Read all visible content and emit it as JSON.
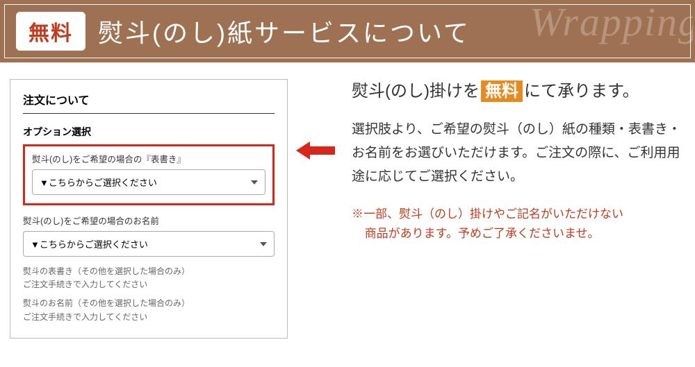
{
  "banner": {
    "badge": "無料",
    "title": "熨斗(のし)紙サービスについて",
    "script_bg": "Wrapping"
  },
  "panel": {
    "heading": "注文について",
    "option_label": "オプション選択",
    "field1": {
      "label": "熨斗(のし)をご希望の場合の『表書き』",
      "placeholder": "▼こちらからご選択ください"
    },
    "field2": {
      "label": "熨斗(のし)をご希望の場合のお名前",
      "placeholder": "▼こちらからご選択ください"
    },
    "note1_line1": "熨斗の表書き（その他を選択した場合のみ）",
    "note1_line2": "ご注文手続きで入力してください",
    "note2_line1": "熨斗のお名前（その他を選択した場合のみ）",
    "note2_line2": "ご注文手続きで入力してください"
  },
  "right": {
    "lead_pre": "熨斗(のし)掛けを",
    "lead_free": "無料",
    "lead_post": "にて承ります。",
    "body": "選択肢より、ご希望の熨斗（のし）紙の種類・表書き・お名前をお選びいただけます。ご注文の際に、ご利用用途に応じてご選択ください。",
    "warning_l1": "※一部、熨斗（のし）掛けやご記名がいただけない",
    "warning_l2": "商品があります。予めご了承くださいませ。"
  }
}
